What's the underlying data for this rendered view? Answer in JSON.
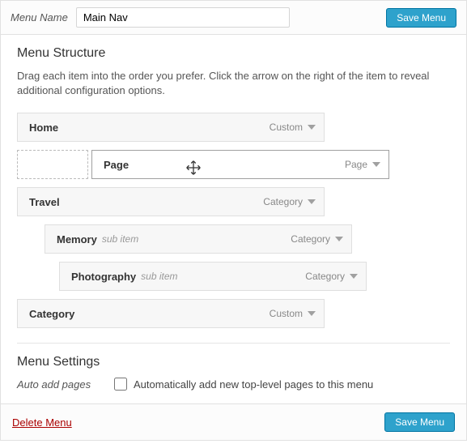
{
  "header": {
    "label": "Menu Name",
    "value": "Main Nav",
    "save_label": "Save Menu"
  },
  "structure": {
    "title": "Menu Structure",
    "help": "Drag each item into the order you prefer. Click the arrow on the right of the item to reveal additional configuration options.",
    "sub_item_label": "sub item",
    "items": [
      {
        "title": "Home",
        "type": "Custom",
        "indent": 0,
        "dragging": false,
        "sub": false,
        "placeholder": false
      },
      {
        "title": "Page",
        "type": "Page",
        "indent": 0,
        "dragging": true,
        "sub": false,
        "placeholder": true
      },
      {
        "title": "Travel",
        "type": "Category",
        "indent": 0,
        "dragging": false,
        "sub": false,
        "placeholder": false
      },
      {
        "title": "Memory",
        "type": "Category",
        "indent": 1,
        "dragging": false,
        "sub": true,
        "placeholder": false
      },
      {
        "title": "Photography",
        "type": "Category",
        "indent": 2,
        "dragging": false,
        "sub": true,
        "placeholder": false
      },
      {
        "title": "Category",
        "type": "Custom",
        "indent": 0,
        "dragging": false,
        "sub": false,
        "placeholder": false
      }
    ]
  },
  "settings": {
    "title": "Menu Settings",
    "auto_add_label": "Auto add pages",
    "auto_add_text": "Automatically add new top-level pages to this menu",
    "auto_add_checked": false
  },
  "footer": {
    "delete_label": "Delete Menu",
    "save_label": "Save Menu"
  }
}
